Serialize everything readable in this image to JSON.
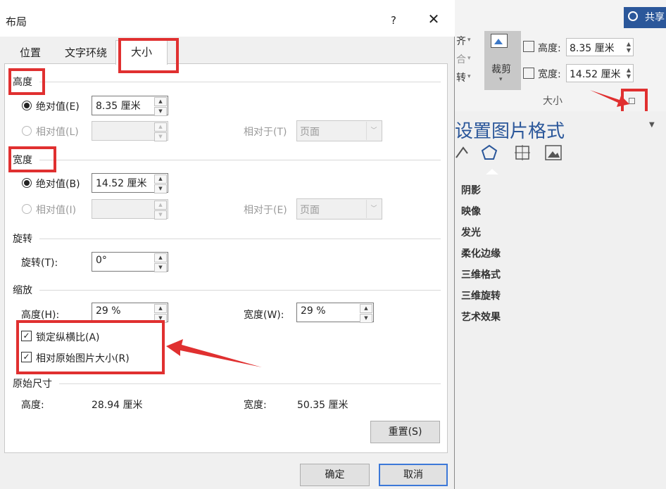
{
  "background": {
    "share_label": "共享",
    "ribbon_fragments": [
      "齐",
      "合",
      "转"
    ],
    "crop_label": "裁剪",
    "height_label": "高度:",
    "height_value": "8.35 厘米",
    "width_label": "宽度:",
    "width_value": "14.52 厘米",
    "group_label": "大小",
    "pane_title": "设置图片格式",
    "pane_items": [
      "阴影",
      "映像",
      "发光",
      "柔化边缘",
      "三维格式",
      "三维旋转",
      "艺术效果"
    ]
  },
  "dialog": {
    "title": "布局",
    "help": "?",
    "close": "✕",
    "tabs": [
      "位置",
      "文字环绕",
      "大小"
    ],
    "height_section": {
      "title": "高度",
      "absolute_label": "绝对值(E)",
      "absolute_value": "8.35 厘米",
      "relative_label": "相对值(L)",
      "relative_value": "",
      "relative_to_label": "相对于(T)",
      "relative_to_value": "页面"
    },
    "width_section": {
      "title": "宽度",
      "absolute_label": "绝对值(B)",
      "absolute_value": "14.52 厘米",
      "relative_label": "相对值(I)",
      "relative_value": "",
      "relative_to_label": "相对于(E)",
      "relative_to_value": "页面"
    },
    "rotate_section": {
      "title": "旋转",
      "rotate_label": "旋转(T):",
      "rotate_value": "0°"
    },
    "scale_section": {
      "title": "缩放",
      "height_label": "高度(H):",
      "height_value": "29 %",
      "width_label": "宽度(W):",
      "width_value": "29 %",
      "lock_aspect_label": "锁定纵横比(A)",
      "lock_aspect_checked": true,
      "relative_original_label": "相对原始图片大小(R)",
      "relative_original_checked": true
    },
    "original_section": {
      "title": "原始尺寸",
      "height_label": "高度:",
      "height_value": "28.94 厘米",
      "width_label": "宽度:",
      "width_value": "50.35 厘米"
    },
    "reset_label": "重置(S)",
    "ok_label": "确定",
    "cancel_label": "取消"
  },
  "colors": {
    "highlight": "#e03030",
    "accent": "#2b579a"
  }
}
